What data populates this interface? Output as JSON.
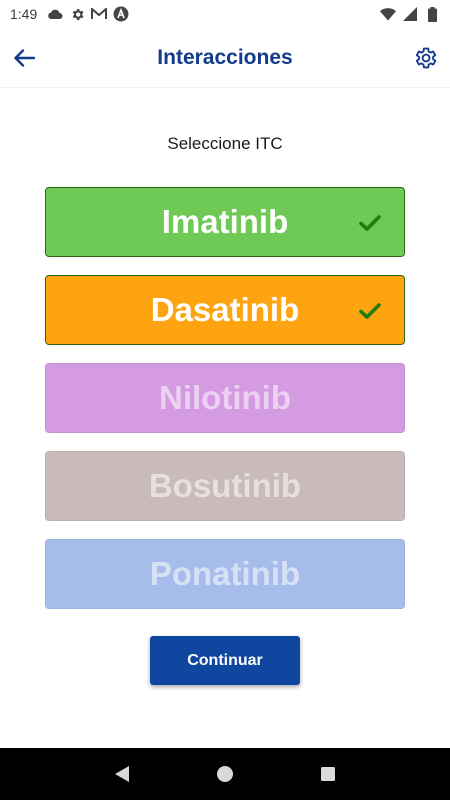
{
  "status_bar": {
    "time": "1:49",
    "left_icons": [
      "cloud-icon",
      "gear-icon",
      "gmail-icon",
      "app-a-icon"
    ],
    "right_icons": [
      "wifi-icon",
      "signal-icon",
      "battery-icon"
    ]
  },
  "app_bar": {
    "title": "Interacciones",
    "back_icon": "arrow-left-icon",
    "settings_icon": "gear-icon",
    "title_color": "#123b8a"
  },
  "main": {
    "prompt": "Seleccione ITC",
    "options": [
      {
        "label": "Imatinib",
        "selected": true,
        "color": "#6ec955"
      },
      {
        "label": "Dasatinib",
        "selected": true,
        "color": "#ffa411"
      },
      {
        "label": "Nilotinib",
        "selected": false,
        "color": "#d49ae2"
      },
      {
        "label": "Bosutinib",
        "selected": false,
        "color": "#c8bbb9"
      },
      {
        "label": "Ponatinib",
        "selected": false,
        "color": "#a6bdec"
      }
    ],
    "check_color": "#1e7d12",
    "continue_label": "Continuar",
    "continue_color": "#0f46a0"
  },
  "nav_bar": {
    "items": [
      "back-triangle-icon",
      "home-circle-icon",
      "recents-square-icon"
    ]
  }
}
